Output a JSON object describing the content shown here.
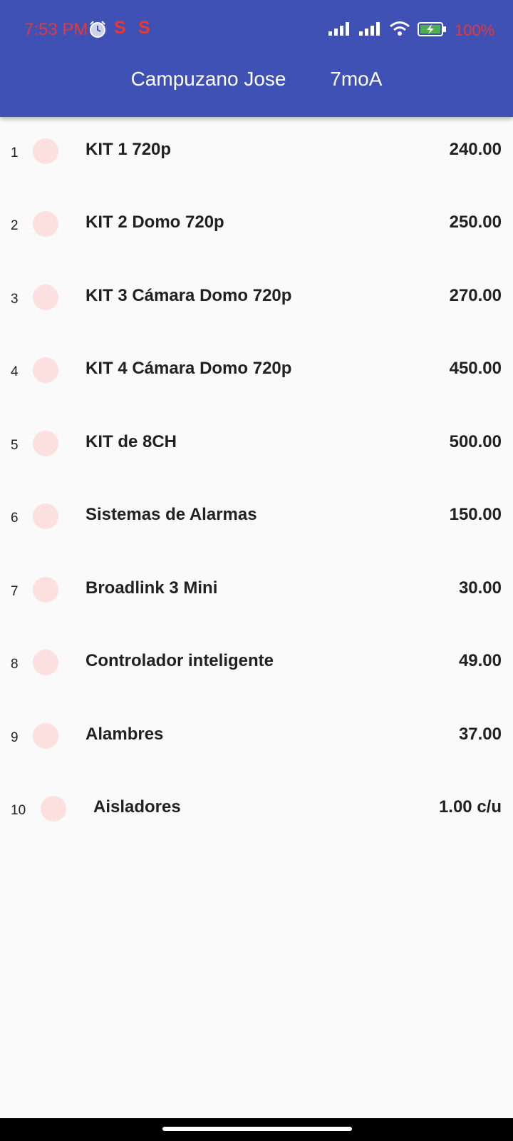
{
  "status_bar": {
    "time": "7:53 PM",
    "battery": "100%",
    "icons": [
      "alarm-icon",
      "s-icon",
      "s-icon",
      "signal-icon",
      "signal-icon",
      "wifi-icon",
      "battery-charging-icon"
    ],
    "time_color": "#e53935"
  },
  "header": {
    "name": "Campuzano Jose",
    "group": "7moA",
    "background": "#3f51b5"
  },
  "items": [
    {
      "index": "1",
      "name": "KIT 1 720p",
      "price": "240.00"
    },
    {
      "index": "2",
      "name": "KIT 2 Domo 720p",
      "price": "250.00"
    },
    {
      "index": "3",
      "name": "KIT 3 Cámara Domo 720p",
      "price": "270.00"
    },
    {
      "index": "4",
      "name": "KIT 4 Cámara Domo 720p",
      "price": "450.00"
    },
    {
      "index": "5",
      "name": "KIT de 8CH",
      "price": "500.00"
    },
    {
      "index": "6",
      "name": "Sistemas de Alarmas",
      "price": "150.00"
    },
    {
      "index": "7",
      "name": "Broadlink 3 Mini",
      "price": "30.00"
    },
    {
      "index": "8",
      "name": "Controlador inteligente",
      "price": "49.00"
    },
    {
      "index": "9",
      "name": "Alambres",
      "price": "37.00"
    },
    {
      "index": "10",
      "name": "Aisladores",
      "price": "1.00 c/u"
    }
  ]
}
